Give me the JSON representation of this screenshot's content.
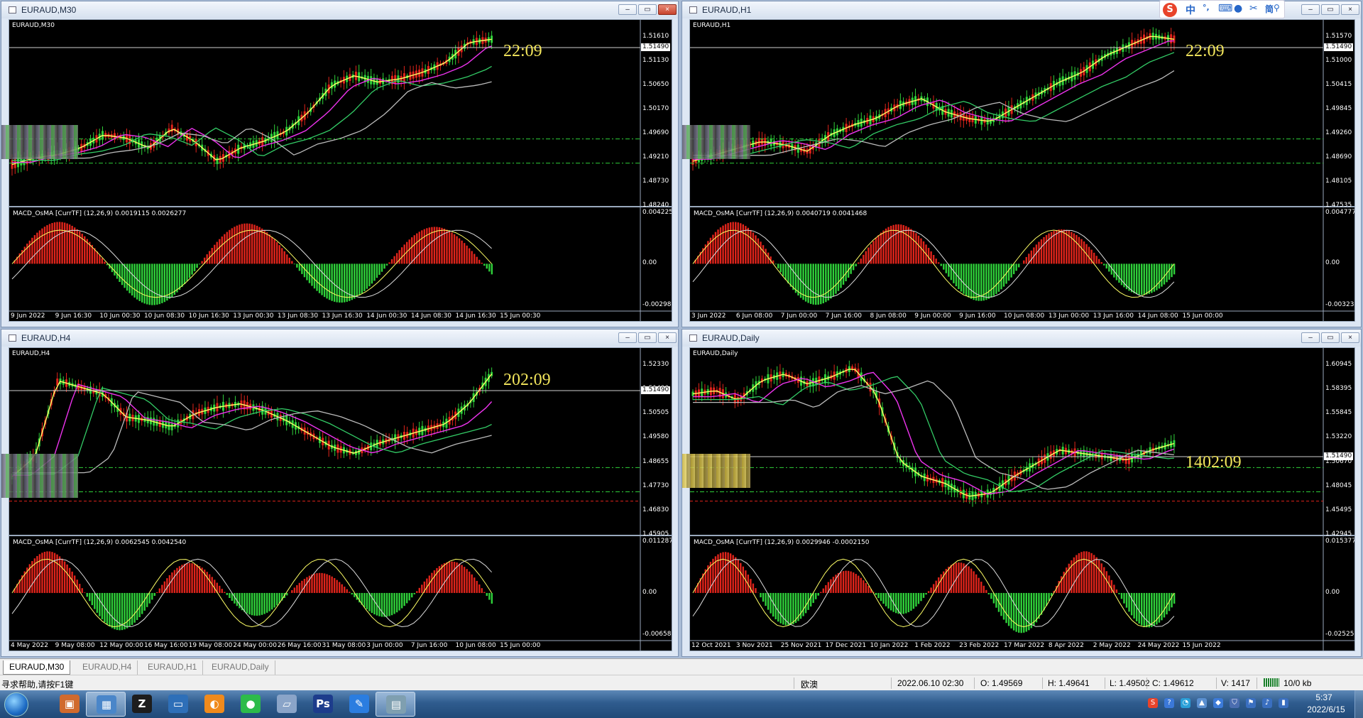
{
  "windows": [
    {
      "title": "EURAUD,M30",
      "tag": "EURAUD,M30",
      "timer": "22:09",
      "indicator": "MACD_OsMA [CurrTF] (12,26,9) 0.0019115 0.0026277",
      "prices": [
        "1.51610",
        "1.51130",
        "1.50650",
        "1.50170",
        "1.49690",
        "1.49210",
        "1.48730",
        "1.48240"
      ],
      "current": "1.51490",
      "macd_scale": [
        "0.0042253",
        "0.00",
        "-0.002989"
      ],
      "dates": [
        "9 Jun 2022",
        "9 Jun 16:30",
        "10 Jun 00:30",
        "10 Jun 08:30",
        "10 Jun 16:30",
        "13 Jun 00:30",
        "13 Jun 08:30",
        "13 Jun 16:30",
        "14 Jun 00:30",
        "14 Jun 08:30",
        "14 Jun 16:30",
        "15 Jun 00:30"
      ],
      "close": "close-x"
    },
    {
      "title": "EURAUD,H1",
      "tag": "EURAUD,H1",
      "timer": "22:09",
      "indicator": "MACD_OsMA [CurrTF] (12,26,9) 0.0040719 0.0041468",
      "prices": [
        "1.51570",
        "1.51000",
        "1.50415",
        "1.49845",
        "1.49260",
        "1.48690",
        "1.48105",
        "1.47535"
      ],
      "current": "1.51490",
      "macd_scale": [
        "0.0047778",
        "0.00",
        "-0.003234"
      ],
      "dates": [
        "3 Jun 2022",
        "6 Jun 08:00",
        "7 Jun 00:00",
        "7 Jun 16:00",
        "8 Jun 08:00",
        "9 Jun 00:00",
        "9 Jun 16:00",
        "10 Jun 08:00",
        "13 Jun 00:00",
        "13 Jun 16:00",
        "14 Jun 08:00",
        "15 Jun 00:00"
      ]
    },
    {
      "title": "EURAUD,H4",
      "tag": "EURAUD,H4",
      "timer": "202:09",
      "indicator": "MACD_OsMA [CurrTF] (12,26,9) 0.0062545 0.0042540",
      "prices": [
        "1.52330",
        "1.51490",
        "1.50505",
        "1.49580",
        "1.48655",
        "1.47730",
        "1.46830",
        "1.45905"
      ],
      "current": "1.51490",
      "macd_scale": [
        "0.0112872",
        "0.00",
        "-0.006587"
      ],
      "dates": [
        "4 May 2022",
        "9 May 08:00",
        "12 May 00:00",
        "16 May 16:00",
        "19 May 08:00",
        "24 May 00:00",
        "26 May 16:00",
        "31 May 08:00",
        "3 Jun 00:00",
        "7 Jun 16:00",
        "10 Jun 08:00",
        "15 Jun 00:00"
      ]
    },
    {
      "title": "EURAUD,Daily",
      "tag": "EURAUD,Daily",
      "timer": "1402:09",
      "indicator": "MACD_OsMA [CurrTF] (12,26,9) 0.0029946 -0.0002150",
      "prices": [
        "1.60945",
        "1.58395",
        "1.55845",
        "1.53220",
        "1.50670",
        "1.48045",
        "1.45495",
        "1.42945"
      ],
      "current": "1.51490",
      "macd_scale": [
        "0.0153772",
        "0.00",
        "-0.025250"
      ],
      "dates": [
        "12 Oct 2021",
        "3 Nov 2021",
        "25 Nov 2021",
        "17 Dec 2021",
        "10 Jan 2022",
        "1 Feb 2022",
        "23 Feb 2022",
        "17 Mar 2022",
        "8 Apr 2022",
        "2 May 2022",
        "24 May 2022",
        "15 Jun 2022"
      ]
    }
  ],
  "tabs": [
    "EURAUD,M30",
    "EURAUD,H4",
    "EURAUD,H1",
    "EURAUD,Daily"
  ],
  "status": {
    "help": "寻求帮助,请按F1键",
    "profile": "欧澳",
    "datetime": "2022.06.10 02:30",
    "open": "O: 1.49569",
    "high": "H: 1.49641",
    "low": "L: 1.49502",
    "close": "C: 1.49612",
    "volume": "V: 1417",
    "traffic": "10/0 kb"
  },
  "clock": {
    "time": "5:37",
    "date": "2022/6/15"
  },
  "ime": {
    "mode": "中"
  },
  "colors": {
    "bull": "#2fd13a",
    "bear": "#e0241b",
    "ma_fast": "#ffff66",
    "ma_mid": "#ee33ee",
    "ma_slow": "#33cc66",
    "ma_long": "#bbbbbb",
    "timer": "#f3e65c"
  },
  "icons": [
    "start-orb-icon",
    "folder-icon",
    "explorer-icon",
    "metatrader-icon",
    "monitor-icon",
    "browser-icon",
    "wechat-icon",
    "notepad-icon",
    "photoshop-icon",
    "pen-icon",
    "trading-terminal-icon"
  ]
}
